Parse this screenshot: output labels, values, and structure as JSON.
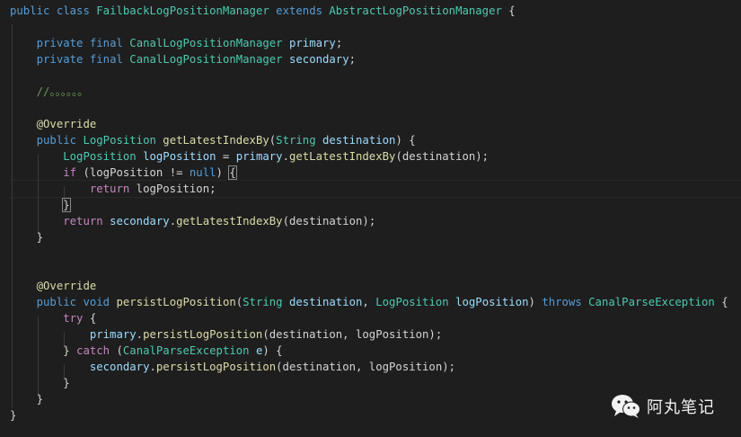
{
  "editor": {
    "lines": [
      [
        {
          "t": "public",
          "c": "kw"
        },
        {
          "t": " ",
          "c": "pln"
        },
        {
          "t": "class",
          "c": "kw"
        },
        {
          "t": " ",
          "c": "pln"
        },
        {
          "t": "FailbackLogPositionManager",
          "c": "type"
        },
        {
          "t": " ",
          "c": "pln"
        },
        {
          "t": "extends",
          "c": "kw"
        },
        {
          "t": " ",
          "c": "pln"
        },
        {
          "t": "AbstractLogPositionManager",
          "c": "type"
        },
        {
          "t": " {",
          "c": "pln"
        }
      ],
      [],
      [
        {
          "t": "    ",
          "c": "pln"
        },
        {
          "t": "private",
          "c": "kw"
        },
        {
          "t": " ",
          "c": "pln"
        },
        {
          "t": "final",
          "c": "kw"
        },
        {
          "t": " ",
          "c": "pln"
        },
        {
          "t": "CanalLogPositionManager",
          "c": "type"
        },
        {
          "t": " ",
          "c": "pln"
        },
        {
          "t": "primary",
          "c": "var"
        },
        {
          "t": ";",
          "c": "pln"
        }
      ],
      [
        {
          "t": "    ",
          "c": "pln"
        },
        {
          "t": "private",
          "c": "kw"
        },
        {
          "t": " ",
          "c": "pln"
        },
        {
          "t": "final",
          "c": "kw"
        },
        {
          "t": " ",
          "c": "pln"
        },
        {
          "t": "CanalLogPositionManager",
          "c": "type"
        },
        {
          "t": " ",
          "c": "pln"
        },
        {
          "t": "secondary",
          "c": "var"
        },
        {
          "t": ";",
          "c": "pln"
        }
      ],
      [],
      [
        {
          "t": "    ",
          "c": "pln"
        },
        {
          "t": "//。。。。。。",
          "c": "cmt"
        }
      ],
      [],
      [
        {
          "t": "    ",
          "c": "pln"
        },
        {
          "t": "@Override",
          "c": "ann"
        }
      ],
      [
        {
          "t": "    ",
          "c": "pln"
        },
        {
          "t": "public",
          "c": "kw"
        },
        {
          "t": " ",
          "c": "pln"
        },
        {
          "t": "LogPosition",
          "c": "type"
        },
        {
          "t": " ",
          "c": "pln"
        },
        {
          "t": "getLatestIndexBy",
          "c": "fn"
        },
        {
          "t": "(",
          "c": "pln"
        },
        {
          "t": "String",
          "c": "type"
        },
        {
          "t": " ",
          "c": "pln"
        },
        {
          "t": "destination",
          "c": "var"
        },
        {
          "t": ") {",
          "c": "pln"
        }
      ],
      [
        {
          "t": "        ",
          "c": "pln"
        },
        {
          "t": "LogPosition",
          "c": "type"
        },
        {
          "t": " ",
          "c": "pln"
        },
        {
          "t": "logPosition",
          "c": "var"
        },
        {
          "t": " = ",
          "c": "pln"
        },
        {
          "t": "primary",
          "c": "var"
        },
        {
          "t": ".",
          "c": "pln"
        },
        {
          "t": "getLatestIndexBy",
          "c": "fn"
        },
        {
          "t": "(destination);",
          "c": "pln"
        }
      ],
      [
        {
          "t": "        ",
          "c": "pln"
        },
        {
          "t": "if",
          "c": "ctl"
        },
        {
          "t": " (logPosition != ",
          "c": "pln"
        },
        {
          "t": "null",
          "c": "kw"
        },
        {
          "t": ") ",
          "c": "pln"
        },
        {
          "t": "{",
          "c": "pln",
          "m": 1
        }
      ],
      [
        {
          "t": "            ",
          "c": "pln"
        },
        {
          "t": "return",
          "c": "ctl"
        },
        {
          "t": " logPosition;",
          "c": "pln"
        }
      ],
      [
        {
          "t": "        ",
          "c": "pln"
        },
        {
          "t": "}",
          "c": "pln",
          "m": 1
        }
      ],
      [
        {
          "t": "        ",
          "c": "pln"
        },
        {
          "t": "return",
          "c": "ctl"
        },
        {
          "t": " ",
          "c": "pln"
        },
        {
          "t": "secondary",
          "c": "var"
        },
        {
          "t": ".",
          "c": "pln"
        },
        {
          "t": "getLatestIndexBy",
          "c": "fn"
        },
        {
          "t": "(destination);",
          "c": "pln"
        }
      ],
      [
        {
          "t": "    }",
          "c": "pln"
        }
      ],
      [],
      [],
      [
        {
          "t": "    ",
          "c": "pln"
        },
        {
          "t": "@Override",
          "c": "ann"
        }
      ],
      [
        {
          "t": "    ",
          "c": "pln"
        },
        {
          "t": "public",
          "c": "kw"
        },
        {
          "t": " ",
          "c": "pln"
        },
        {
          "t": "void",
          "c": "kw"
        },
        {
          "t": " ",
          "c": "pln"
        },
        {
          "t": "persistLogPosition",
          "c": "fn"
        },
        {
          "t": "(",
          "c": "pln"
        },
        {
          "t": "String",
          "c": "type"
        },
        {
          "t": " ",
          "c": "pln"
        },
        {
          "t": "destination",
          "c": "var"
        },
        {
          "t": ", ",
          "c": "pln"
        },
        {
          "t": "LogPosition",
          "c": "type"
        },
        {
          "t": " ",
          "c": "pln"
        },
        {
          "t": "logPosition",
          "c": "var"
        },
        {
          "t": ") ",
          "c": "pln"
        },
        {
          "t": "throws",
          "c": "kw"
        },
        {
          "t": " ",
          "c": "pln"
        },
        {
          "t": "CanalParseException",
          "c": "type"
        },
        {
          "t": " {",
          "c": "pln"
        }
      ],
      [
        {
          "t": "        ",
          "c": "pln"
        },
        {
          "t": "try",
          "c": "ctl"
        },
        {
          "t": " {",
          "c": "pln"
        }
      ],
      [
        {
          "t": "            ",
          "c": "pln"
        },
        {
          "t": "primary",
          "c": "var"
        },
        {
          "t": ".",
          "c": "pln"
        },
        {
          "t": "persistLogPosition",
          "c": "fn"
        },
        {
          "t": "(destination, logPosition);",
          "c": "pln"
        }
      ],
      [
        {
          "t": "        } ",
          "c": "pln"
        },
        {
          "t": "catch",
          "c": "ctl"
        },
        {
          "t": " (",
          "c": "pln"
        },
        {
          "t": "CanalParseException",
          "c": "type"
        },
        {
          "t": " ",
          "c": "pln"
        },
        {
          "t": "e",
          "c": "var"
        },
        {
          "t": ") {",
          "c": "pln"
        }
      ],
      [
        {
          "t": "            ",
          "c": "pln"
        },
        {
          "t": "secondary",
          "c": "var"
        },
        {
          "t": ".",
          "c": "pln"
        },
        {
          "t": "persistLogPosition",
          "c": "fn"
        },
        {
          "t": "(destination, logPosition);",
          "c": "pln"
        }
      ],
      [
        {
          "t": "        }",
          "c": "pln"
        }
      ],
      [
        {
          "t": "    }",
          "c": "pln"
        }
      ],
      [
        {
          "t": "}",
          "c": "pln"
        }
      ]
    ]
  },
  "watermark": {
    "icon": "wechat-icon",
    "text": "阿丸笔记"
  }
}
